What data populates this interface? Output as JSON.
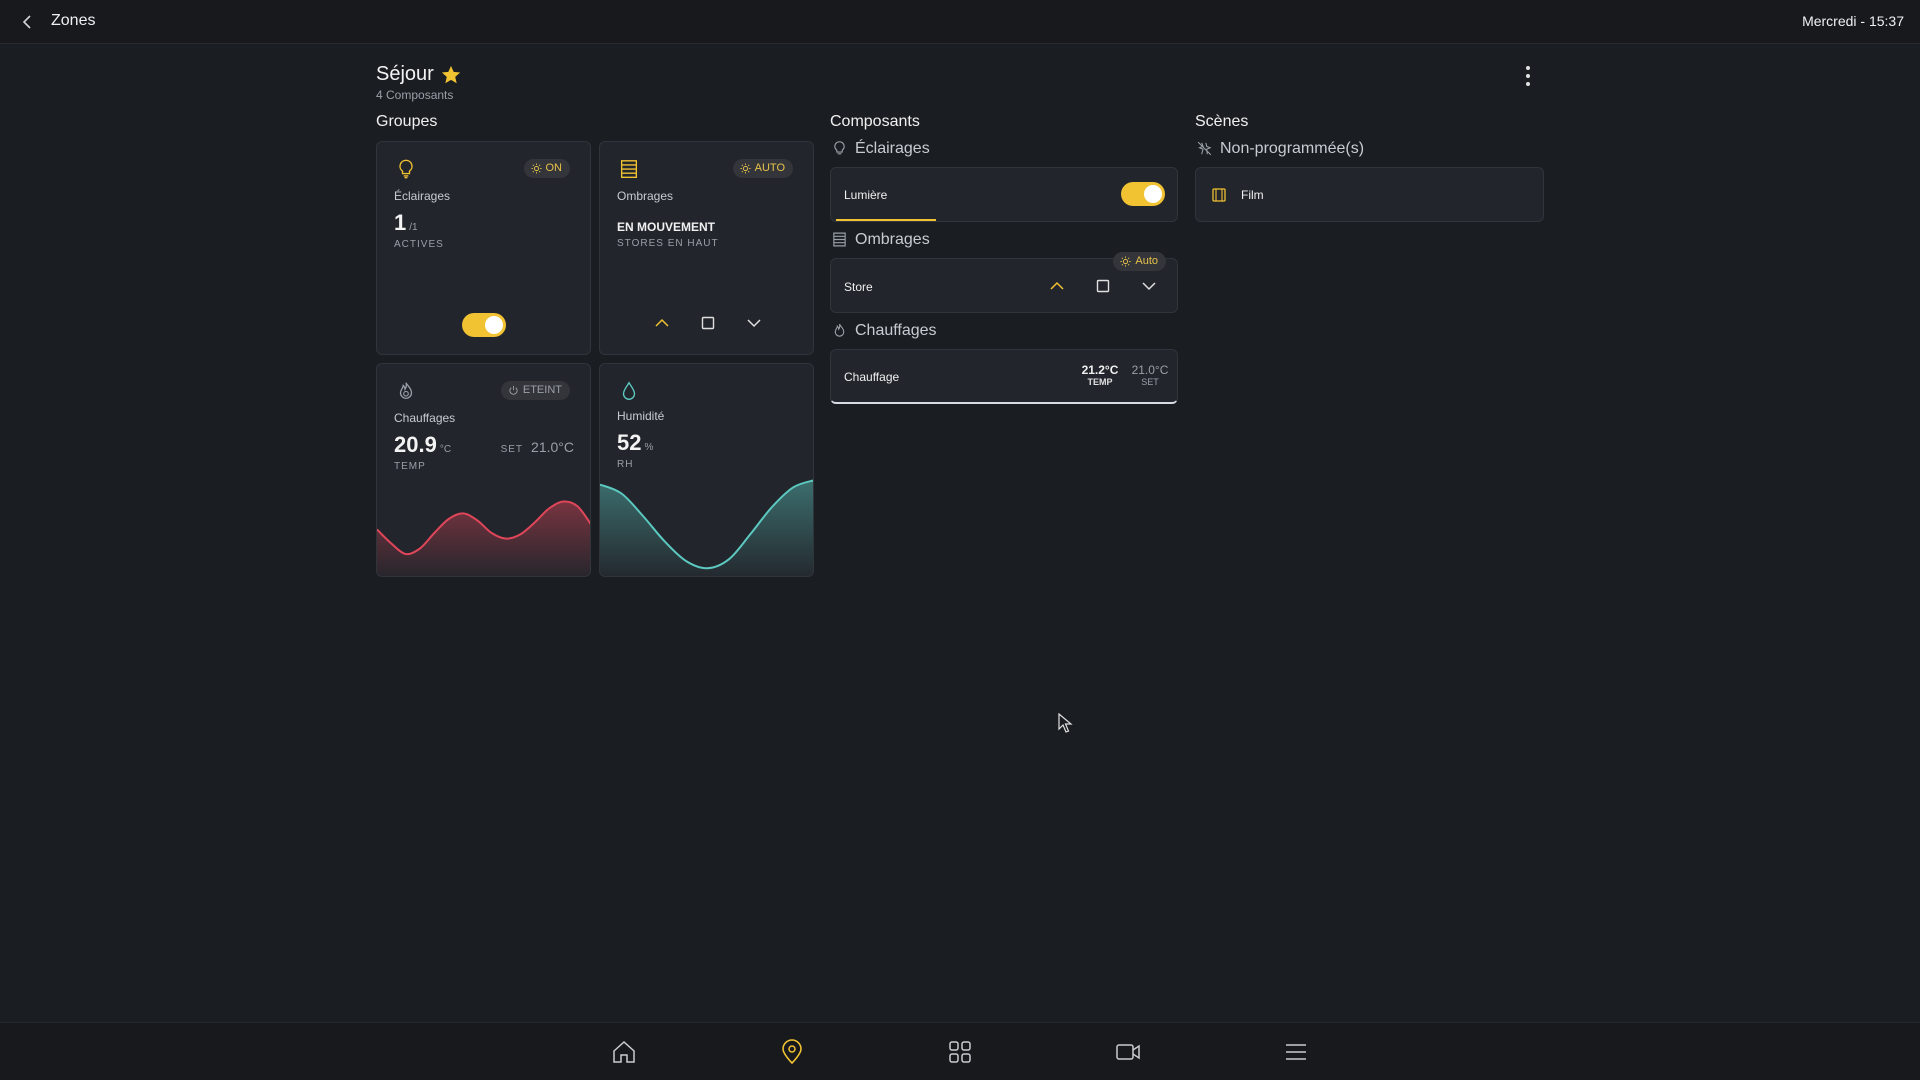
{
  "topbar": {
    "title": "Zones",
    "datetime": "Mercredi - 15:37"
  },
  "room": {
    "name": "Séjour",
    "subtitle": "4 Composants",
    "favorite": true
  },
  "sections": {
    "groups": "Groupes",
    "components": "Composants",
    "scenes": "Scènes"
  },
  "groups": {
    "lighting": {
      "label": "Éclairages",
      "badge": "ON",
      "count": "1",
      "total": "/1",
      "caption": "ACTIVES",
      "on": true
    },
    "shading": {
      "label": "Ombrages",
      "badge": "AUTO",
      "status": "EN MOUVEMENT",
      "caption": "STORES EN HAUT"
    },
    "heating": {
      "label": "Chauffages",
      "badge": "ETEINT",
      "temp": "20.9",
      "unit": "°C",
      "temp_caption": "TEMP",
      "set_label": "SET",
      "set_value": "21.0°C",
      "trend": [
        0.55,
        0.35,
        0.2,
        0.28,
        0.5,
        0.7,
        0.78,
        0.68,
        0.5,
        0.42,
        0.48,
        0.65,
        0.85,
        0.95,
        0.88,
        0.6
      ]
    },
    "humidity": {
      "label": "Humidité",
      "value": "52",
      "unit": "%",
      "caption": "RH",
      "trend": [
        0.95,
        0.85,
        0.6,
        0.32,
        0.1,
        0.02,
        0.12,
        0.4,
        0.7,
        0.92,
        1.0
      ]
    }
  },
  "components": {
    "lighting": {
      "heading": "Éclairages",
      "item": "Lumière",
      "on": true
    },
    "shading": {
      "heading": "Ombrages",
      "item": "Store",
      "badge": "Auto"
    },
    "heating": {
      "heading": "Chauffages",
      "item": "Chauffage",
      "temp": "21.2°C",
      "temp_caption": "TEMP",
      "set": "21.0°C",
      "set_caption": "SET"
    }
  },
  "scenes": {
    "heading": "Non-programmée(s)",
    "item": "Film"
  },
  "colors": {
    "accent": "#f1c232",
    "heat": "#e0465a",
    "humidity": "#5cc8c0",
    "background": "#1a1d22",
    "card": "#22252b"
  },
  "bottom_nav": [
    "home-icon",
    "location-pin-icon",
    "grid-icon",
    "camera-icon",
    "menu-icon"
  ]
}
